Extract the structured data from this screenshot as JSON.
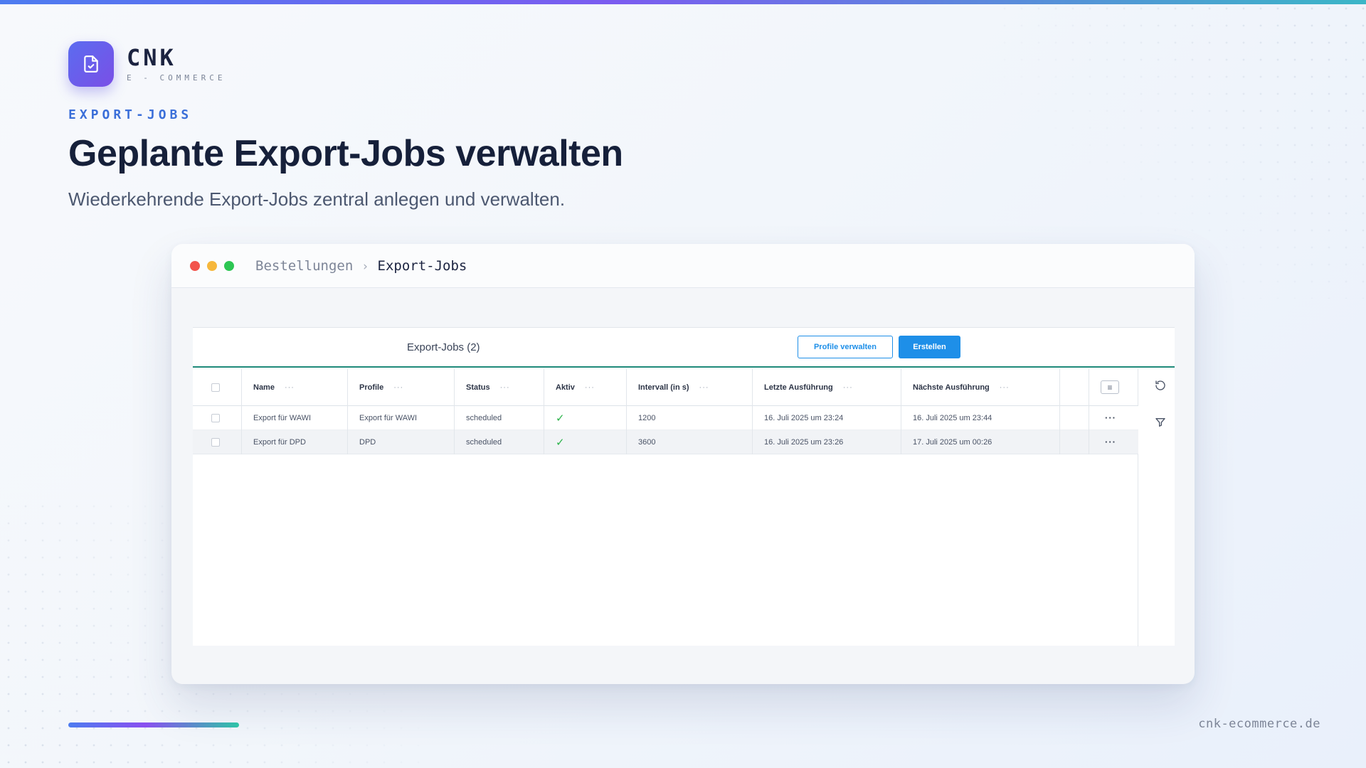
{
  "brand": {
    "name": "CNK",
    "tagline": "E - COMMERCE",
    "logo_icon": "document-check-icon",
    "accent_colors": [
      "#4d7cf0",
      "#7b5cf0",
      "#3bb6c7"
    ]
  },
  "hero": {
    "eyebrow": "EXPORT-JOBS",
    "title": "Geplante Export-Jobs verwalten",
    "subtitle": "Wiederkehrende Export-Jobs zentral anlegen und verwalten."
  },
  "window": {
    "breadcrumb": [
      "Bestellungen",
      "Export-Jobs"
    ],
    "breadcrumb_separator": "›"
  },
  "panel": {
    "title": "Export-Jobs (2)",
    "manage_profiles_label": "Profile verwalten",
    "create_label": "Erstellen",
    "primary_color": "#1e8fe8",
    "accent_line_color": "#1f8a7a"
  },
  "table": {
    "columns": [
      "Name",
      "Profile",
      "Status",
      "Aktiv",
      "Intervall (in s)",
      "Letzte Ausführung",
      "Nächste Ausführung"
    ],
    "column_menu_glyph": "···",
    "row_menu_glyph": "···",
    "rows": [
      {
        "name": "Export für WAWI",
        "profile": "Export für WAWI",
        "status": "scheduled",
        "aktiv": "✓",
        "interval": "1200",
        "last_run": "16. Juli 2025 um 23:24",
        "next_run": "16. Juli 2025 um 23:44"
      },
      {
        "name": "Export für DPD",
        "profile": "DPD",
        "status": "scheduled",
        "aktiv": "✓",
        "interval": "3600",
        "last_run": "16. Juli 2025 um 23:26",
        "next_run": "17. Juli 2025 um 00:26"
      }
    ],
    "active_check_color": "#2bb34a"
  },
  "tools": {
    "refresh_icon": "refresh-icon",
    "filter_icon": "filter-icon",
    "column_settings_icon": "list-icon"
  },
  "footer": {
    "domain": "cnk-ecommerce.de"
  }
}
